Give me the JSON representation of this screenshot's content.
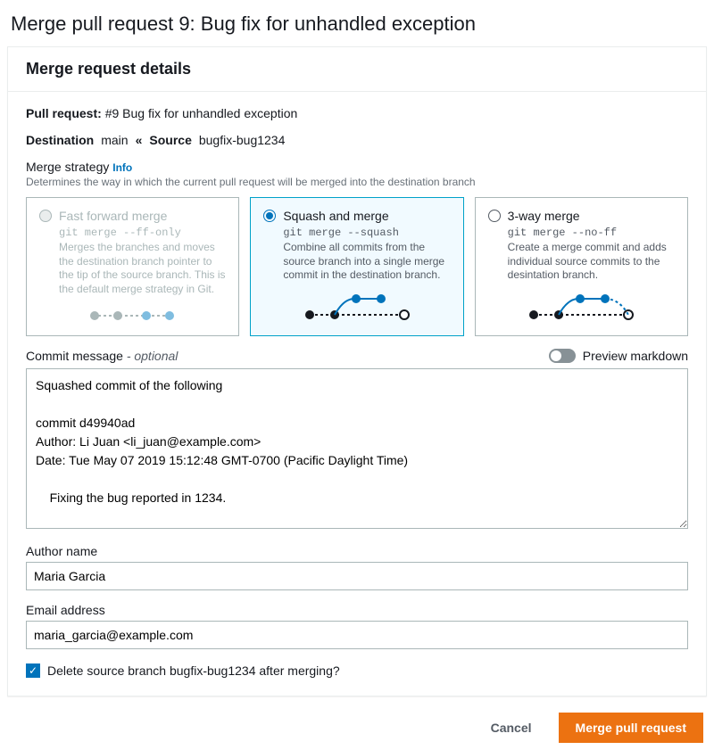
{
  "page_title": "Merge pull request 9: Bug fix for unhandled exception",
  "panel_title": "Merge request details",
  "pull_request": {
    "label": "Pull request:",
    "number": "#9",
    "title": "Bug fix for unhandled exception"
  },
  "branches": {
    "dest_label": "Destination",
    "dest_name": "main",
    "src_label": "Source",
    "src_name": "bugfix-bug1234"
  },
  "strategy": {
    "label": "Merge strategy",
    "info": "Info",
    "help": "Determines the way in which the current pull request will be merged into the destination branch",
    "options": [
      {
        "title": "Fast forward merge",
        "code": "git merge --ff-only",
        "desc": "Merges the branches and moves the destination branch pointer to the tip of the source branch. This is the default merge strategy in Git.",
        "disabled": true,
        "selected": false
      },
      {
        "title": "Squash and merge",
        "code": "git merge --squash",
        "desc": "Combine all commits from the source branch into a single merge commit in the destination branch.",
        "disabled": false,
        "selected": true
      },
      {
        "title": "3-way merge",
        "code": "git merge --no-ff",
        "desc": "Create a merge commit and adds individual source commits to the desintation branch.",
        "disabled": false,
        "selected": false
      }
    ]
  },
  "commit": {
    "label": "Commit message",
    "optional": "- optional",
    "preview_label": "Preview markdown",
    "message": "Squashed commit of the following\n\ncommit d49940ad\nAuthor: Li Juan <li_juan@example.com>\nDate: Tue May 07 2019 15:12:48 GMT-0700 (Pacific Daylight Time)\n\n    Fixing the bug reported in 1234."
  },
  "author": {
    "name_label": "Author name",
    "name_value": "Maria Garcia",
    "email_label": "Email address",
    "email_value": "maria_garcia@example.com"
  },
  "delete_branch": {
    "checked": true,
    "label": "Delete source branch bugfix-bug1234 after merging?"
  },
  "actions": {
    "cancel": "Cancel",
    "merge": "Merge pull request"
  }
}
